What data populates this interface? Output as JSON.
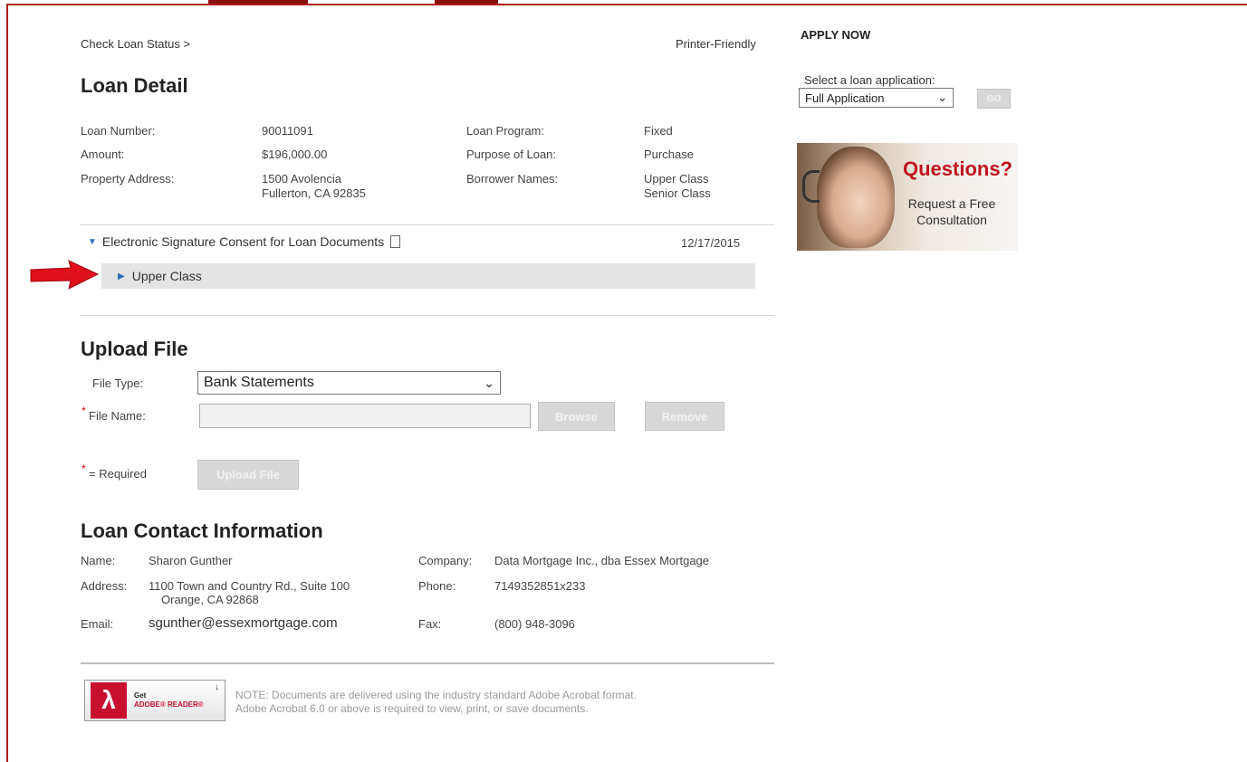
{
  "breadcrumb": "Check Loan Status >",
  "printer_friendly": "Printer-Friendly",
  "loan_detail": {
    "title": "Loan Detail",
    "loan_number_label": "Loan Number:",
    "loan_number": "90011091",
    "amount_label": "Amount:",
    "amount": "$196,000.00",
    "property_address_label": "Property Address:",
    "property_address_line1": "1500 Avolencia",
    "property_address_line2": "Fullerton, CA 92835",
    "loan_program_label": "Loan Program:",
    "loan_program": "Fixed",
    "purpose_label": "Purpose of Loan:",
    "purpose": "Purchase",
    "borrower_names_label": "Borrower Names:",
    "borrower_1": "Upper Class",
    "borrower_2": "Senior Class"
  },
  "documents": {
    "consent_title": "Electronic Signature Consent for Loan Documents",
    "consent_date": "12/17/2015",
    "sub_item": "Upper Class"
  },
  "upload": {
    "title": "Upload File",
    "file_type_label": "File Type:",
    "file_type_value": "Bank Statements",
    "file_name_label": "File Name:",
    "browse_label": "Browse",
    "remove_label": "Remove",
    "required_label": "= Required",
    "upload_button_label": "Upload File"
  },
  "contact": {
    "title": "Loan Contact Information",
    "name_label": "Name:",
    "name": "Sharon Gunther",
    "address_label": "Address:",
    "address_line1": "1100 Town and Country Rd., Suite 100",
    "address_line2": "Orange, CA 92868",
    "email_label": "Email:",
    "email": "sgunther@essexmortgage.com",
    "company_label": "Company:",
    "company": "Data Mortgage Inc., dba Essex Mortgage",
    "phone_label": "Phone:",
    "phone": "7149352851x233",
    "fax_label": "Fax:",
    "fax": "(800) 948-3096"
  },
  "adobe": {
    "badge_line1": "Get",
    "badge_line2": "ADOBE® READER®",
    "note_line1": "NOTE: Documents are delivered using the industry standard Adobe Acrobat format.",
    "note_line2": "Adobe Acrobat 6.0 or above is required to view, print, or save documents."
  },
  "sidebar": {
    "apply_now": "APPLY NOW",
    "select_label": "Select a loan application:",
    "select_value": "Full Application",
    "go_label": "GO",
    "promo_title": "Questions?",
    "promo_line1": "Request a Free",
    "promo_line2": "Consultation"
  },
  "colors": {
    "frame": "#b01c1c",
    "promo_red": "#c0141c",
    "arrow_red": "#e0101a",
    "required_star": "#cc0000"
  }
}
